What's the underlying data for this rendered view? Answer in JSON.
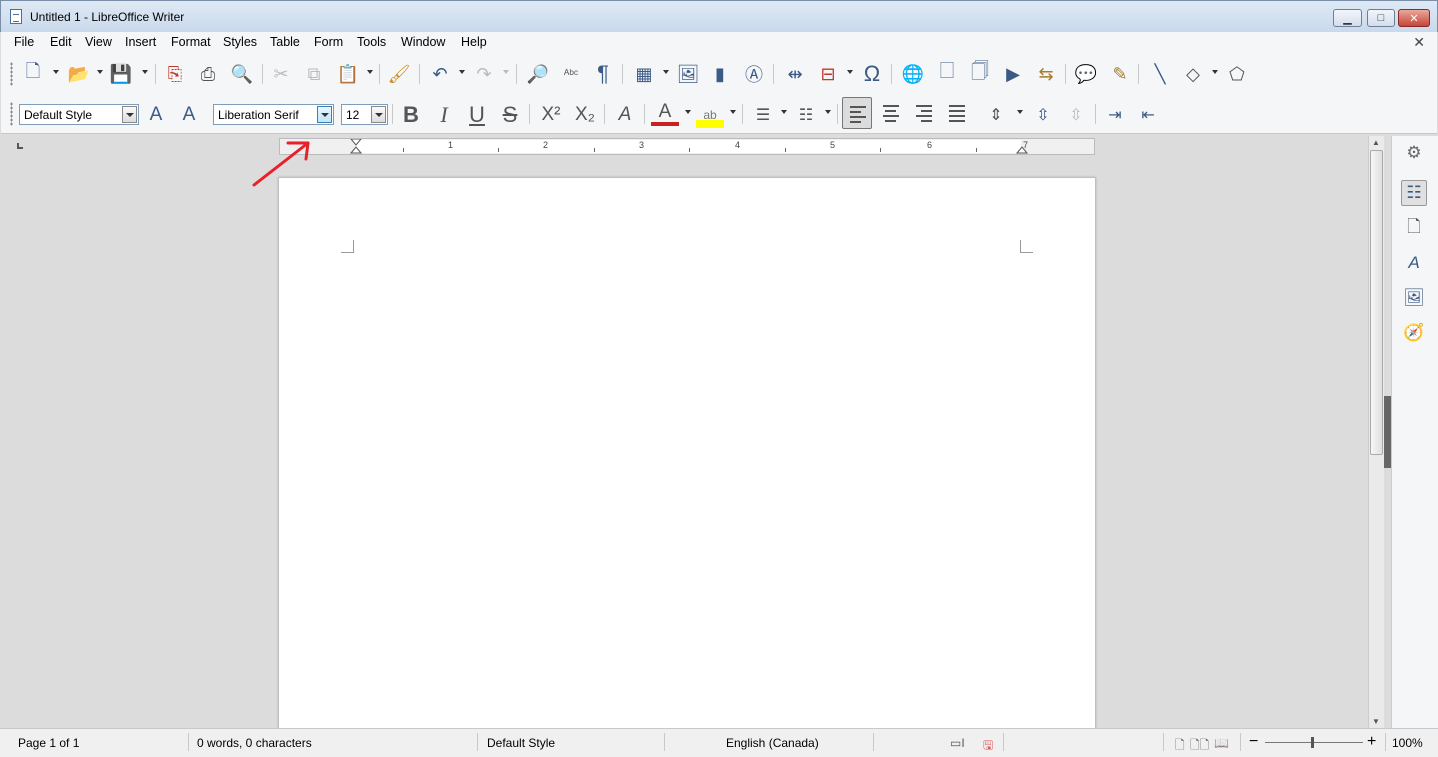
{
  "window": {
    "title": "Untitled 1 - LibreOffice Writer",
    "min_label": "▁",
    "max_label": "□",
    "close_label": "✕"
  },
  "menu": {
    "items": [
      "File",
      "Edit",
      "View",
      "Insert",
      "Format",
      "Styles",
      "Table",
      "Form",
      "Tools",
      "Window",
      "Help"
    ],
    "close_doc": "✕"
  },
  "formatting": {
    "paragraph_style": "Default Style",
    "font_name": "Liberation Serif",
    "font_size": "12"
  },
  "ruler": {
    "numbers": [
      "1",
      "2",
      "3",
      "4",
      "5",
      "6",
      "7"
    ]
  },
  "statusbar": {
    "page": "Page 1 of 1",
    "words": "0 words, 0 characters",
    "page_style": "Default Style",
    "language": "English (Canada)",
    "zoom": "100%"
  },
  "colors": {
    "font_color": "#c9211e",
    "highlight_color": "#ffff00",
    "annotation_arrow": "#e8202a",
    "icon_blue": "#3c5a86"
  }
}
